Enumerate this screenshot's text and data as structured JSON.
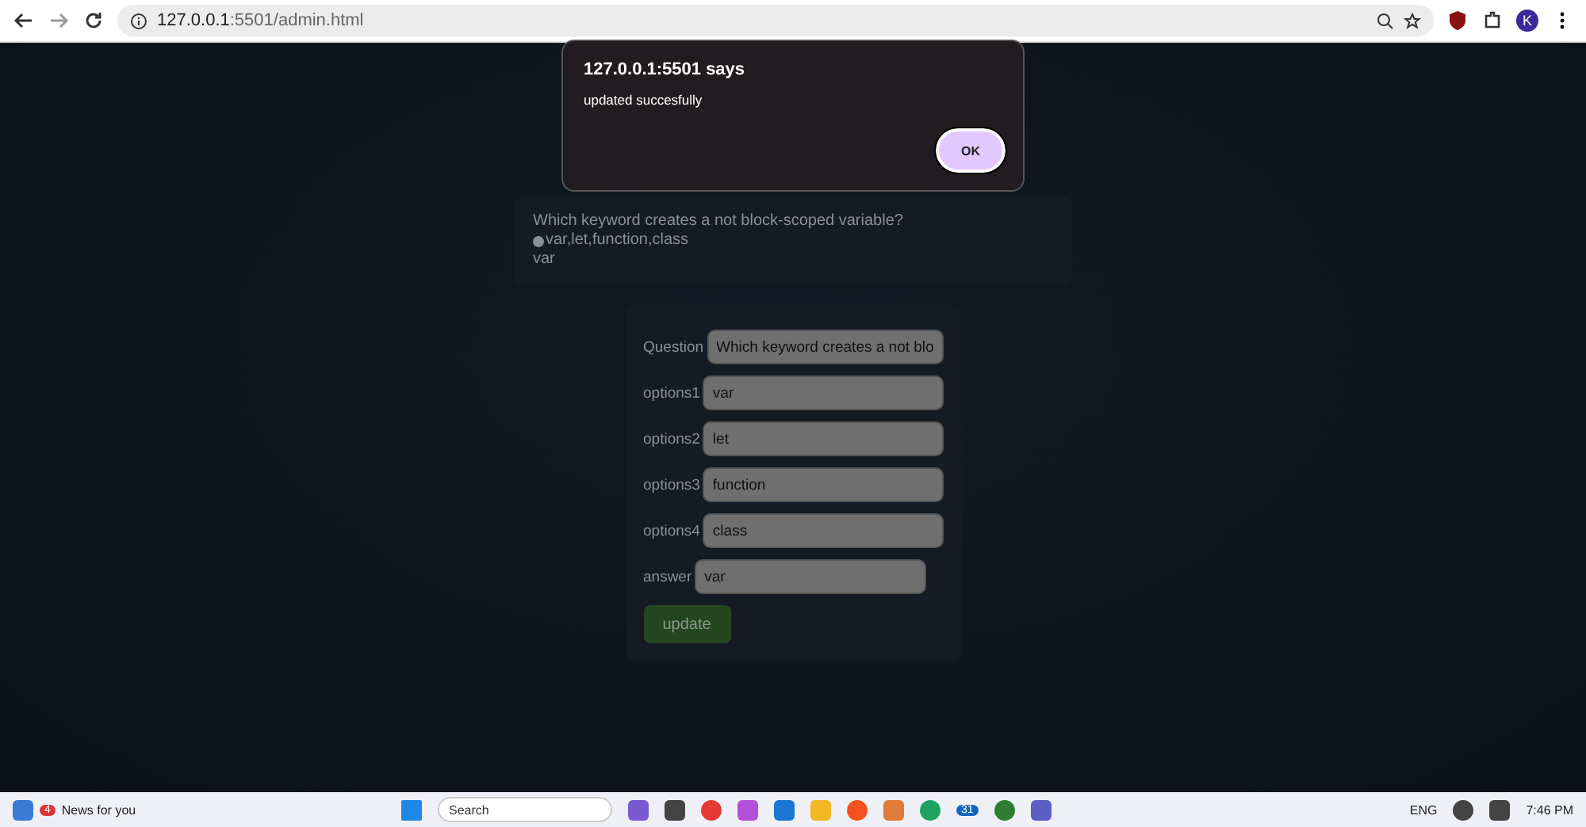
{
  "browser": {
    "url_host": "127.0.0.1",
    "url_rest": ":5501/admin.html",
    "profile_initial": "K"
  },
  "alert": {
    "title": "127.0.0.1:5501 says",
    "message": "updated succesfully",
    "ok": "OK"
  },
  "question_card": {
    "question": "Which keyword creates a not block-scoped variable?",
    "options": "var,let,function,class",
    "answer": "var"
  },
  "form": {
    "fields": [
      {
        "label": "Question",
        "value": "Which keyword creates a not blo"
      },
      {
        "label": "options1",
        "value": "var"
      },
      {
        "label": "options2",
        "value": "let"
      },
      {
        "label": "options3",
        "value": "function"
      },
      {
        "label": "options4",
        "value": "class"
      },
      {
        "label": "answer",
        "value": "var"
      }
    ],
    "submit": "update"
  },
  "taskbar": {
    "news_badge": "4",
    "news_title": "News for you",
    "search_placeholder": "Search",
    "chat_badge": "31",
    "language": "ENG",
    "time": "7:46 PM"
  }
}
